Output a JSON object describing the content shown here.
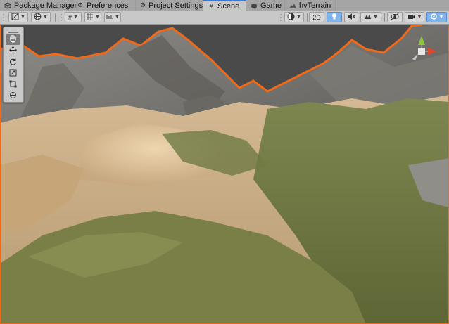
{
  "tabs": [
    {
      "label": "Package Manager",
      "icon": "package-icon",
      "active": false
    },
    {
      "label": "Preferences",
      "icon": "gear-icon",
      "active": false
    },
    {
      "label": "Project Settings",
      "icon": "gear-icon",
      "active": false
    },
    {
      "label": "Scene",
      "icon": "grid-icon",
      "active": true
    },
    {
      "label": "Game",
      "icon": "gamepad-icon",
      "active": false
    },
    {
      "label": "hvTerrain",
      "icon": "terrain-icon",
      "active": false
    }
  ],
  "toolbar": {
    "mode_2d_label": "2D"
  },
  "tools": [
    {
      "name": "hand-tool",
      "icon": "hand-icon",
      "selected": true
    },
    {
      "name": "move-tool",
      "icon": "move-icon",
      "selected": false
    },
    {
      "name": "rotate-tool",
      "icon": "rotate-icon",
      "selected": false
    },
    {
      "name": "scale-tool",
      "icon": "scale-icon",
      "selected": false
    },
    {
      "name": "rect-tool",
      "icon": "rect-icon",
      "selected": false
    },
    {
      "name": "transform-tool",
      "icon": "transform-icon",
      "selected": false
    }
  ],
  "colors": {
    "selection_outline": "#f06a1a",
    "active_tab_accent": "#3a79d3",
    "toolbar_toggle_on": "#7fb3ea",
    "sky": "#4a4a4a"
  }
}
